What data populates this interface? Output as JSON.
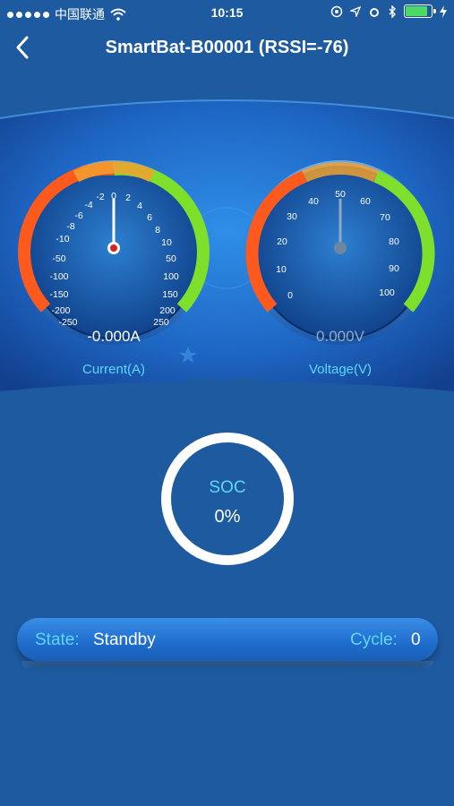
{
  "status_bar": {
    "carrier": "中国联通",
    "time": "10:15"
  },
  "header": {
    "title": "SmartBat-B00001 (RSSI=-76)"
  },
  "current_gauge": {
    "ticks_left": [
      "-2",
      "-4",
      "-6",
      "-8",
      "-10",
      "-50",
      "-100",
      "-150",
      "-200",
      "-250"
    ],
    "ticks_right": [
      "0",
      "2",
      "4",
      "6",
      "8",
      "10",
      "50",
      "100",
      "150",
      "200",
      "250"
    ],
    "value": "-0.000A",
    "label": "Current(A)"
  },
  "voltage_gauge": {
    "ticks": [
      "0",
      "10",
      "20",
      "30",
      "40",
      "50",
      "60",
      "70",
      "80",
      "90",
      "100"
    ],
    "value": "0.000V",
    "label": "Voltage(V)"
  },
  "soc": {
    "label": "SOC",
    "value": "0%"
  },
  "state_bar": {
    "state_label": "State:",
    "state_value": "Standby",
    "cycle_label": "Cycle:",
    "cycle_value": "0"
  },
  "colors": {
    "background": "#1d5aa0",
    "accent_cyan": "#5fd7ff",
    "gauge_red": "#ff5a1e",
    "gauge_green": "#7ee02b"
  }
}
